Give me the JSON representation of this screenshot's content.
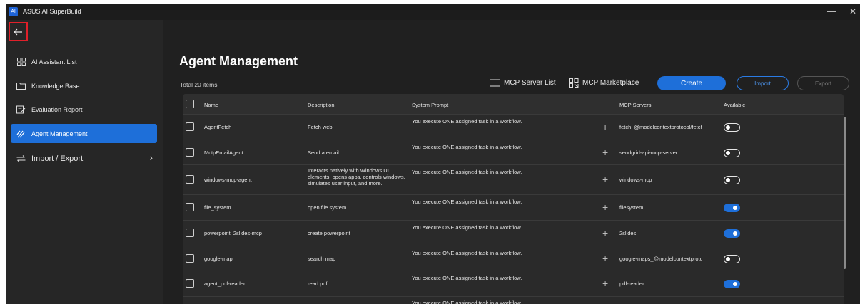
{
  "window": {
    "title": "ASUS AI SuperBuild",
    "min": "—",
    "close": "✕"
  },
  "sidebar": {
    "back_icon": "arrow-left-icon",
    "items": [
      {
        "label": "AI Assistant List",
        "icon": "grid-icon"
      },
      {
        "label": "Knowledge Base",
        "icon": "folder-icon"
      },
      {
        "label": "Evaluation Report",
        "icon": "report-icon"
      },
      {
        "label": "Agent Management",
        "icon": "agent-icon",
        "active": true
      },
      {
        "label": "Import / Export",
        "icon": "swap-icon",
        "chevron": "›"
      }
    ]
  },
  "main": {
    "title": "Agent Management",
    "total": "Total 20 items",
    "toolbar": {
      "mcp_server_list": "MCP Server List",
      "mcp_marketplace": "MCP Marketplace",
      "create": "Create",
      "import": "Import",
      "export": "Export"
    },
    "columns": {
      "name": "Name",
      "description": "Description",
      "system_prompt": "System Prompt",
      "mcp_servers": "MCP Servers",
      "available": "Available"
    },
    "rows": [
      {
        "name": "AgentFetch",
        "description": "Fetch web",
        "prompt": "You execute ONE assigned task in a workflow.",
        "mcp": "fetch_@modelcontextprotocol/fetch",
        "available": false
      },
      {
        "name": "MctpEmailAgent",
        "description": "Send a email",
        "prompt": "You execute ONE assigned task in a workflow.",
        "mcp": "sendgrid-api-mcp-server",
        "available": false
      },
      {
        "name": "windows-mcp-agent",
        "description": "Interacts natively with Windows UI elements, opens apps, controls windows, simulates user input, and more.",
        "prompt": "You execute ONE assigned task in a workflow.",
        "mcp": "windows-mcp",
        "available": false
      },
      {
        "name": "file_system",
        "description": "open file system",
        "prompt": "You execute ONE assigned task in a workflow.",
        "mcp": "filesystem",
        "available": true
      },
      {
        "name": "powerpoint_2slides-mcp",
        "description": "create powerpoint",
        "prompt": "You execute ONE assigned task in a workflow.",
        "mcp": "2slides",
        "available": true
      },
      {
        "name": "google-map",
        "description": "search map",
        "prompt": "You execute ONE assigned task in a workflow.",
        "mcp": "google-maps_@modelcontextprotocol/g",
        "available": false
      },
      {
        "name": "agent_pdf-reader",
        "description": "read pdf",
        "prompt": "You execute ONE assigned task in a workflow.",
        "mcp": "pdf-reader",
        "available": true
      },
      {
        "name": "",
        "description": "",
        "prompt": "You execute ONE assigned task in a workflow.",
        "mcp": "",
        "available": null
      }
    ]
  },
  "colors": {
    "accent": "#1e6fd9",
    "highlight_border": "#e0202a",
    "background": "#202020"
  }
}
